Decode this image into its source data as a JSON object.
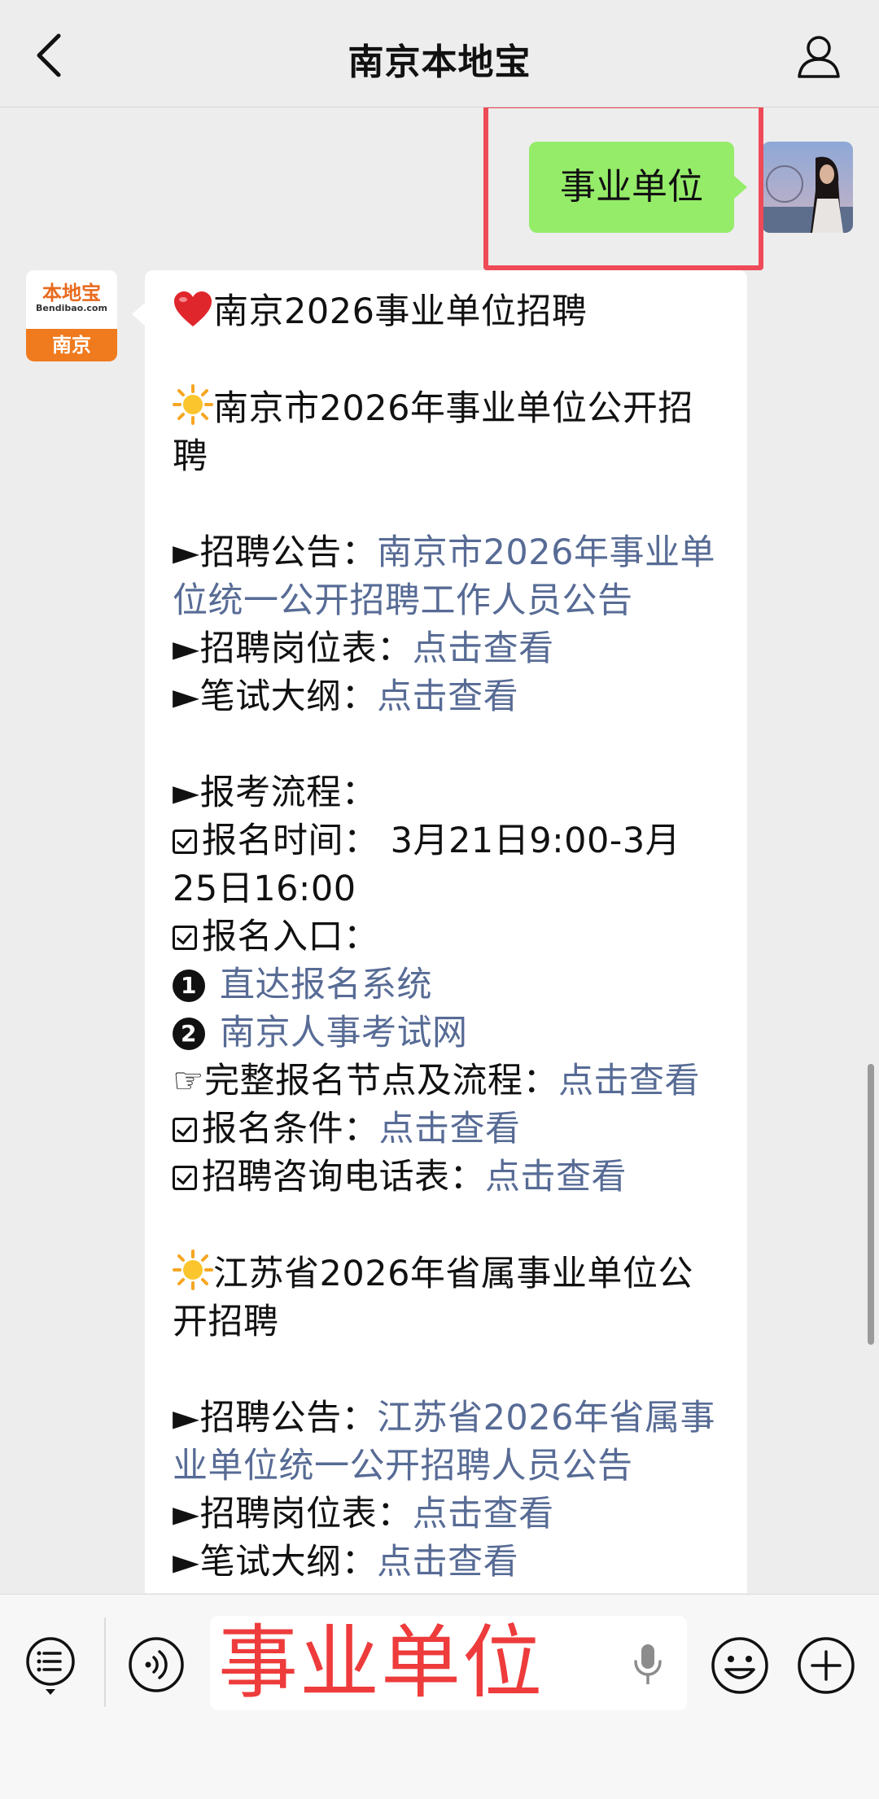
{
  "header": {
    "title": "南京本地宝"
  },
  "sent_message": {
    "text": "事业单位"
  },
  "bot": {
    "logo_text": "本地宝",
    "logo_sub": "Bendibao.com",
    "city": "南京"
  },
  "message": {
    "heading": "南京2026事业单位招聘",
    "nj": {
      "title": "南京市2026年事业单位公开招聘",
      "notice_label": "►招聘公告：",
      "notice_link": "南京市2026年事业单位统一公开招聘工作人员公告",
      "positions_label": "►招聘岗位表：",
      "positions_link": "点击查看",
      "syllabus_label": "►笔试大纲：",
      "syllabus_link": "点击查看",
      "process_label": "►报考流程：",
      "time_text": "报名时间： 3月21日9:00-3月25日16:00",
      "entry_label": "报名入口：",
      "entry1_num": "1",
      "entry1_link": "直达报名系统",
      "entry2_num": "2",
      "entry2_link": "南京人事考试网",
      "flow_label": "☞完整报名节点及流程：",
      "flow_link": "点击查看",
      "cond_label": "报名条件：",
      "cond_link": "点击查看",
      "phone_label": "招聘咨询电话表：",
      "phone_link": "点击查看"
    },
    "js": {
      "title": "江苏省2026年省属事业单位公开招聘",
      "notice_label": "►招聘公告：",
      "notice_link": "江苏省2026年省属事业单位统一公开招聘人员公告",
      "positions_label": "►招聘岗位表：",
      "positions_link": "点击查看",
      "syllabus_label": "►笔试大纲：",
      "syllabus_link": "点击查看"
    }
  },
  "input": {
    "value": "事业单位"
  },
  "colors": {
    "sent_bubble": "#95ec69",
    "link": "#576b95",
    "highlight": "#ee4a57",
    "input_text": "#ee3b3b"
  }
}
